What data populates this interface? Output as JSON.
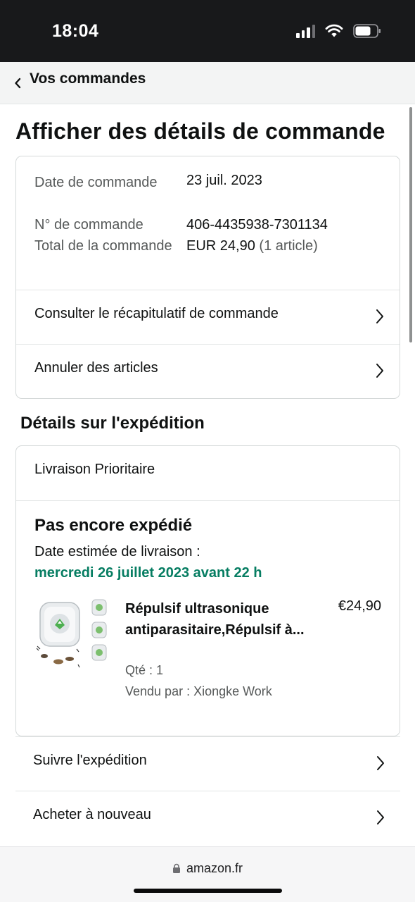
{
  "status_bar": {
    "time": "18:04",
    "icons": [
      "cellular-signal-icon",
      "wifi-icon",
      "battery-icon"
    ]
  },
  "header": {
    "back_label": "Vos commandes"
  },
  "page_title": "Afficher des détails de commande",
  "order_info": {
    "date_label": "Date de commande",
    "date_value": "23 juil. 2023",
    "number_label": "N° de commande",
    "number_value": "406-4435938-7301134",
    "total_label": "Total de la commande",
    "total_value": "EUR 24,90",
    "total_count": "(1 article)",
    "links": [
      {
        "label": "Consulter le récapitulatif de commande"
      },
      {
        "label": "Annuler des articles"
      }
    ]
  },
  "shipping": {
    "section_title": "Détails sur l'expédition",
    "delivery_type": "Livraison Prioritaire",
    "status": "Pas encore expédié",
    "estimate_label": "Date estimée de livraison :",
    "estimate_date": "mercredi 26 juillet 2023 avant 22 h",
    "product": {
      "title": "Répulsif ultrasonique antiparasitaire,Répulsif à...",
      "price": "€24,90",
      "quantity": "Qté : 1",
      "seller": "Vendu par : Xiongke Work"
    }
  },
  "actions": [
    {
      "label": "Suivre l'expédition"
    },
    {
      "label": "Acheter à nouveau"
    }
  ],
  "browser": {
    "url": "amazon.fr"
  },
  "colors": {
    "status_bar_bg": "#18191b",
    "delivery_green": "#067d62",
    "text_primary": "#0f1111",
    "text_secondary": "#565959"
  }
}
